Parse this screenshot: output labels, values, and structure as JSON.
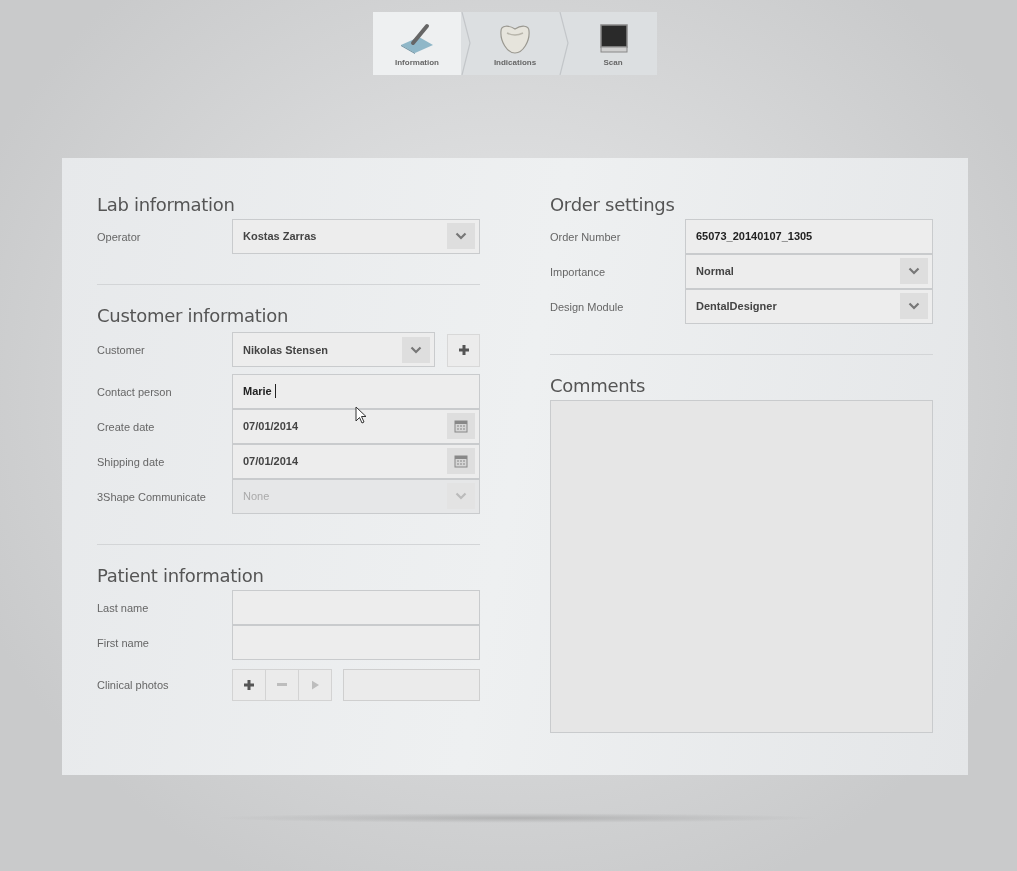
{
  "steps": [
    {
      "label": "Information",
      "kind": "pencil",
      "selected": true
    },
    {
      "label": "Indications",
      "kind": "tooth",
      "selected": false
    },
    {
      "label": "Scan",
      "kind": "monitor",
      "selected": false
    }
  ],
  "columns": [
    {
      "sections": [
        {
          "kind": "form",
          "title": "Lab information",
          "rows": [
            {
              "label": "Operator",
              "kind": "dropdown",
              "value": "Kostas Zarras",
              "disabled": false
            }
          ]
        },
        {
          "kind": "form",
          "title": "Customer information",
          "rows": [
            {
              "label": "Customer",
              "kind": "dropdown_add",
              "value": "Nikolas Stensen",
              "disabled": false
            },
            {
              "label": "Contact person",
              "kind": "text",
              "value": "Marie",
              "focused": true
            },
            {
              "label": "Create date",
              "kind": "date",
              "value": "07/01/2014"
            },
            {
              "label": "Shipping date",
              "kind": "date",
              "value": "07/01/2014"
            },
            {
              "label": "3Shape Communicate",
              "kind": "dropdown",
              "value": "None",
              "disabled": true
            }
          ]
        },
        {
          "kind": "form",
          "title": "Patient information",
          "rows": [
            {
              "label": "Last name",
              "kind": "text",
              "focused": false
            },
            {
              "label": "First name",
              "kind": "text",
              "focused": false
            },
            {
              "label": "Clinical photos",
              "kind": "photos",
              "buttons": [
                {
                  "kind": "add",
                  "disabled": false
                },
                {
                  "kind": "remove",
                  "disabled": true
                },
                {
                  "kind": "play",
                  "disabled": true
                }
              ]
            }
          ]
        }
      ]
    },
    {
      "sections": [
        {
          "kind": "form",
          "title": "Order settings",
          "rows": [
            {
              "label": "Order Number",
              "kind": "text",
              "value": "65073_20140107_1305",
              "focused": false
            },
            {
              "label": "Importance",
              "kind": "dropdown",
              "value": "Normal",
              "disabled": false
            },
            {
              "label": "Design Module",
              "kind": "dropdown",
              "value": "DentalDesigner",
              "disabled": false
            }
          ]
        },
        {
          "kind": "comments",
          "title": "Comments"
        }
      ]
    }
  ]
}
